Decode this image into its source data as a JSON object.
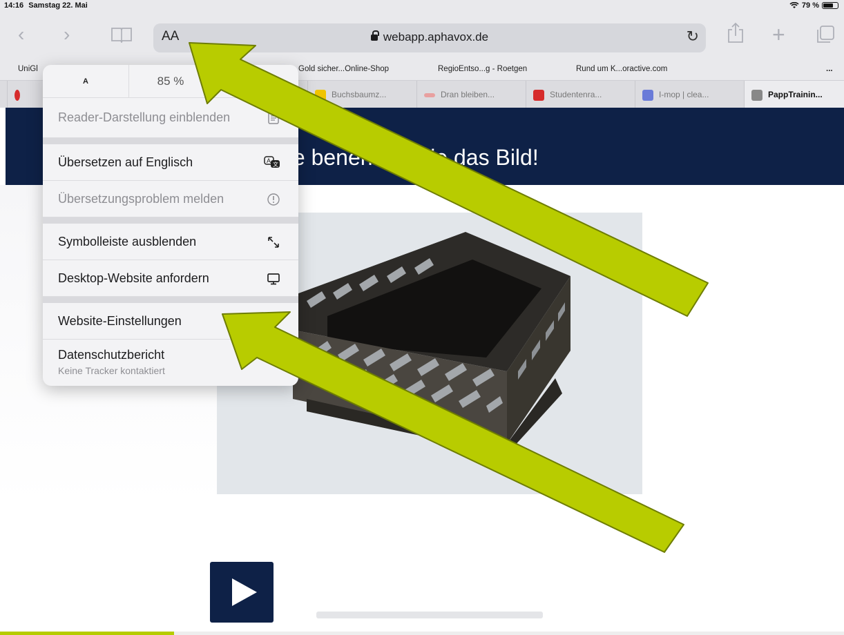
{
  "status_bar": {
    "time": "14:16",
    "date": "Samstag 22. Mai",
    "battery": "79 %"
  },
  "toolbar": {
    "text_size_label": "AA",
    "url": "webapp.aphavox.de",
    "icons": [
      "back-icon",
      "forward-icon",
      "bookmarks-book-icon",
      "reload-icon",
      "share-icon",
      "new-tab-plus-icon",
      "tabs-overview-icon"
    ]
  },
  "bookmarks": [
    {
      "label": "UniGl"
    },
    {
      "label": "Gold sicher...Online-Shop"
    },
    {
      "label": "RegioEntso...g - Roetgen"
    },
    {
      "label": "Rund um K...oractive.com"
    }
  ],
  "bookmarks_more": "...",
  "tabs": [
    {
      "label": "Buchsbaumz...",
      "color": "#f0c400"
    },
    {
      "label": "Dran bleiben...",
      "color": "#e8a0a0"
    },
    {
      "label": "Studentenra...",
      "color": "#d62b2b"
    },
    {
      "label": "I-mop | clea...",
      "color": "#6a7bd8"
    },
    {
      "label": "PappTrainin...",
      "color": "#888888"
    }
  ],
  "page": {
    "title": "Bitte benennen Sie das Bild!",
    "title_visible": "te benennen Sie das Bild!",
    "header_color": "#0e2147",
    "accent_color": "#b6cc00"
  },
  "menu": {
    "zoom_small": "A",
    "zoom_level": "85 %",
    "zoom_large": "A",
    "items": [
      {
        "label": "Reader-Darstellung einblenden",
        "icon": "reader-icon",
        "enabled": false
      },
      {
        "label": "Übersetzen auf Englisch",
        "icon": "translate-icon",
        "enabled": true
      },
      {
        "label": "Übersetzungsproblem melden",
        "icon": "info-icon",
        "enabled": false
      },
      {
        "label": "Symbolleiste ausblenden",
        "icon": "collapse-arrows-icon",
        "enabled": true
      },
      {
        "label": "Desktop-Website anfordern",
        "icon": "desktop-icon",
        "enabled": true
      },
      {
        "label": "Website-Einstellungen",
        "icon": "settings-gear-icon",
        "enabled": true
      },
      {
        "label": "Datenschutzbericht",
        "sublabel": "Keine Tracker kontaktiert",
        "icon": "privacy-shield-icon",
        "enabled": true
      }
    ]
  },
  "annotations": {
    "arrow_color": "#b8cc00",
    "arrow_outline": "#6e7d00"
  }
}
